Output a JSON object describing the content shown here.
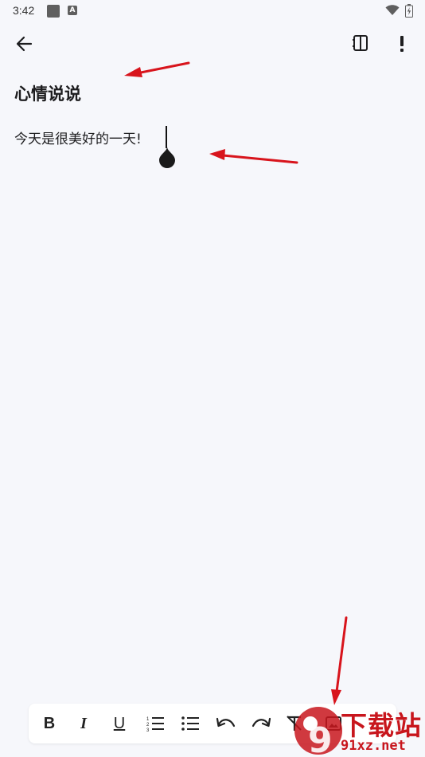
{
  "status_bar": {
    "time": "3:42",
    "notification_icons": [
      "square-icon",
      "a-icon"
    ],
    "a_label": "A",
    "system_icons": [
      "wifi-icon",
      "battery-icon"
    ]
  },
  "top_bar": {
    "back_icon": "arrow-left-icon",
    "split_icon": "split-view-icon",
    "more_icon": "exclamation-icon"
  },
  "note": {
    "title": "心情说说",
    "body": "今天是很美好的一天!"
  },
  "toolbar": {
    "items": [
      {
        "name": "bold",
        "label": "B"
      },
      {
        "name": "italic",
        "label": "I"
      },
      {
        "name": "underline",
        "label": "U"
      },
      {
        "name": "numbered-list",
        "icon": "numbered-list-icon"
      },
      {
        "name": "bulleted-list",
        "icon": "bulleted-list-icon"
      },
      {
        "name": "undo",
        "icon": "undo-icon"
      },
      {
        "name": "redo",
        "icon": "redo-icon"
      },
      {
        "name": "clear-format",
        "icon": "clear-format-icon"
      },
      {
        "name": "insert-image",
        "icon": "image-icon"
      }
    ]
  },
  "watermark": {
    "top": "下载站",
    "bottom": "91xz.net",
    "logo_text": "9"
  },
  "colors": {
    "background": "#f6f7fb",
    "annotation_arrow": "#d8141c",
    "watermark": "#c8161d"
  }
}
